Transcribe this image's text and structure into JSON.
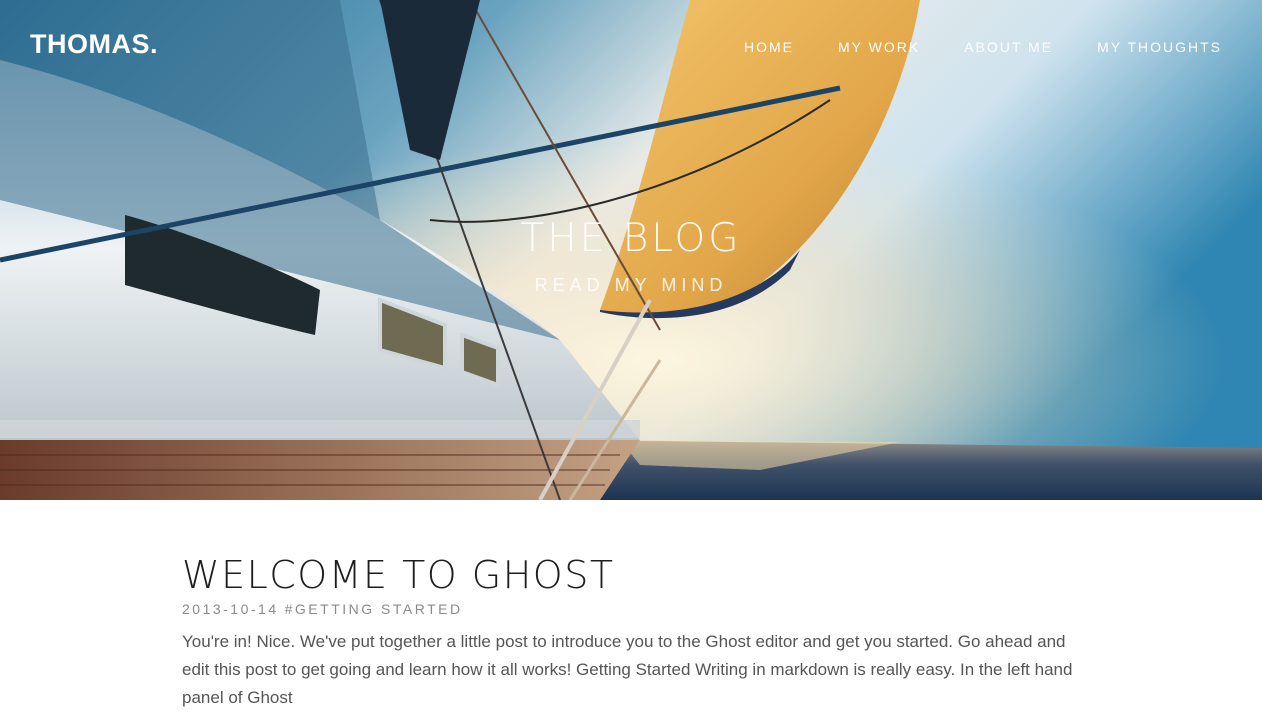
{
  "site": {
    "logo": "THOMAS."
  },
  "nav": {
    "items": [
      {
        "label": "HOME"
      },
      {
        "label": "MY WORK"
      },
      {
        "label": "ABOUT ME"
      },
      {
        "label": "MY THOUGHTS"
      }
    ]
  },
  "hero": {
    "title": "THE BLOG",
    "subtitle": "READ MY MIND"
  },
  "post": {
    "title": "WELCOME TO GHOST",
    "date": "2013-10-14",
    "tag": "#GETTING STARTED",
    "excerpt": "You're in! Nice. We've put together a little post to introduce you to the Ghost editor and get you started. Go ahead and edit this post to get going and learn how it all works! Getting Started Writing in markdown is really easy. In the left hand panel of Ghost"
  },
  "colors": {
    "sky_top": "#2f87b0",
    "sun_glow": "#f6e7c9",
    "sail": "#e9b155",
    "sea": "#1d3a55",
    "deck": "#7a4a36"
  }
}
